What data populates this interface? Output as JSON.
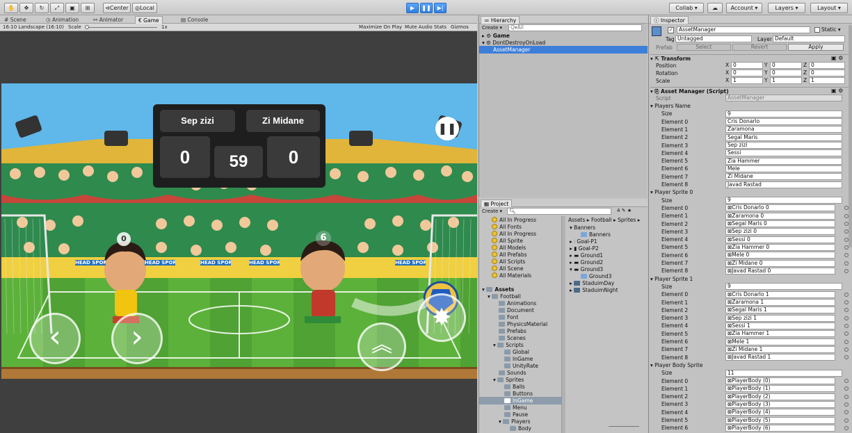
{
  "toolbar": {
    "center_label": "Center",
    "local_label": "Local",
    "collab_label": "Collab",
    "account_label": "Account",
    "layers_label": "Layers",
    "layout_label": "Layout"
  },
  "game_tabs": {
    "scene": "Scene",
    "animation": "Animation",
    "animator": "Animator",
    "game": "Game",
    "console": "Console"
  },
  "game_bar": {
    "aspect": "16:10 Landscape (16:10)",
    "scale_label": "Scale",
    "scale_value": "1x",
    "maximize": "Maximize On Play",
    "mute": "Mute Audio",
    "stats": "Stats",
    "gizmos": "Gizmos"
  },
  "game": {
    "player1": "Sep zizi",
    "player2": "Zi Midane",
    "score1": "0",
    "score2": "0",
    "timer": "59",
    "bubble1": "0",
    "bubble2": "6",
    "banner": "HEAD SPORTS!"
  },
  "hierarchy": {
    "title": "Hierarchy",
    "create": "Create",
    "search": "Q▾All",
    "items": [
      "Game",
      "DontDestroyOnLoad",
      "AssetManager"
    ]
  },
  "project": {
    "title": "Project",
    "create": "Create",
    "count": "4",
    "favorites": [
      "All In Progress",
      "All Fonts",
      "All In Progress",
      "All Sprite",
      "All Models",
      "All Prefabs",
      "All Scripts",
      "All Scene",
      "All Materials"
    ],
    "tree": [
      "Assets",
      "Football",
      "Animations",
      "Document",
      "Font",
      "PhysicsMaterial",
      "Prefabs",
      "Scenes",
      "Scripts",
      "Global",
      "InGame",
      "UnityRate",
      "Sounds",
      "Sprites",
      "Balls",
      "Buttons",
      "InGame",
      "Menu",
      "Pause",
      "Players",
      "Body"
    ],
    "breadcrumb": "Assets ▸ Football ▸ Sprites ▸",
    "assets": [
      "Banners",
      "Banners",
      "Goal-P1",
      "Goal-P2",
      "Ground1",
      "Ground2",
      "Ground3",
      "Ground3",
      "StaduimDay",
      "StaduimNight"
    ]
  },
  "inspector": {
    "title": "Inspector",
    "object_name": "AssetManager",
    "static_label": "Static",
    "tag_label": "Tag",
    "tag_value": "Untagged",
    "layer_label": "Layer",
    "layer_value": "Default",
    "prefab_label": "Prefab",
    "select": "Select",
    "revert": "Revert",
    "apply": "Apply",
    "transform": {
      "title": "Transform",
      "position": "Position",
      "rotation": "Rotation",
      "scale": "Scale",
      "pos": [
        "0",
        "0",
        "0"
      ],
      "rot": [
        "0",
        "0",
        "0"
      ],
      "scl": [
        "1",
        "1",
        "1"
      ],
      "x": "X",
      "y": "Y",
      "z": "Z"
    },
    "script_title": "Asset Manager (Script)",
    "script_label": "Script",
    "script_value": "AssetManager",
    "players_name": {
      "title": "Players Name",
      "size_label": "Size",
      "size": "9",
      "labels": [
        "Element 0",
        "Element 1",
        "Element 2",
        "Element 3",
        "Element 4",
        "Element 5",
        "Element 6",
        "Element 7",
        "Element 8"
      ],
      "values": [
        "Cris Donarlo",
        "Zaramona",
        "Segal Maris",
        "Sep zizi",
        "Sessi",
        "Zia Hammer",
        "Mele",
        "Zi Midane",
        "Javad Rastad"
      ]
    },
    "sprite0": {
      "title": "Player Sprite 0",
      "size": "9",
      "values": [
        "Cris Donarlo 0",
        "Zaramona 0",
        "Segal Maris 0",
        "Sep zizi 0",
        "Sessi 0",
        "Zia Hammer 0",
        "Mele 0",
        "Zi Midane 0",
        "Javad Rastad 0"
      ]
    },
    "sprite1": {
      "title": "Player Sprite 1",
      "size": "9",
      "values": [
        "Cris Donarlo 1",
        "Zaramona 1",
        "Segal Maris 1",
        "Sep zizi 1",
        "Sessi 1",
        "Zia Hammer 1",
        "Mele 1",
        "Zi Midane 1",
        "Javad Rastad 1"
      ]
    },
    "body": {
      "title": "Player Body Sprite",
      "size": "11",
      "values": [
        "PlayerBody (0)",
        "PlayerBody (1)",
        "PlayerBody (2)",
        "PlayerBody (3)",
        "PlayerBody (4)",
        "PlayerBody (5)",
        "PlayerBody (6)"
      ]
    }
  }
}
